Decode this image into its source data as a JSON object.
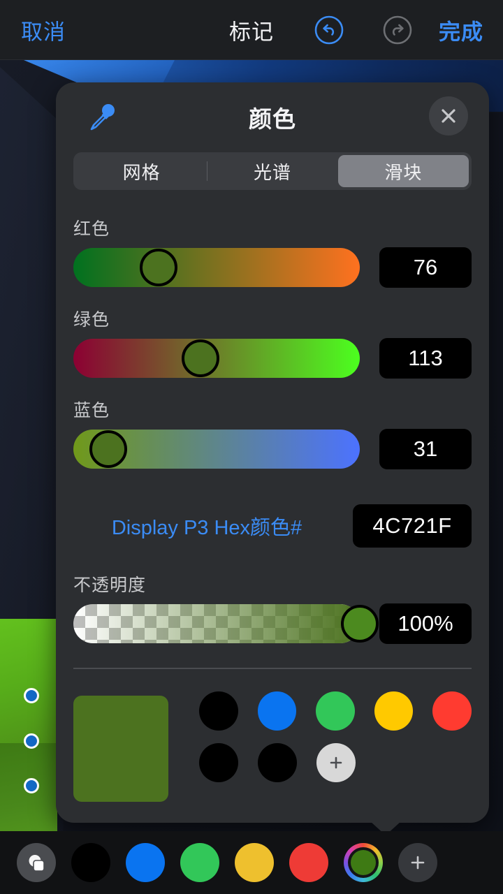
{
  "topbar": {
    "cancel_label": "取消",
    "title": "标记",
    "done_label": "完成",
    "undo_icon": "undo-icon",
    "redo_icon": "redo-icon",
    "undo_color": "#3b8cf5",
    "redo_color": "#6d6f73"
  },
  "popover": {
    "title": "颜色",
    "eyedropper_icon": "eyedropper-icon",
    "close_icon": "close-icon",
    "segments": [
      {
        "label": "网格",
        "selected": false
      },
      {
        "label": "光谱",
        "selected": false
      },
      {
        "label": "滑块",
        "selected": true
      }
    ],
    "sliders": [
      {
        "label": "红色",
        "value": "76",
        "percent": 29.8,
        "gradient_from": "#00711f",
        "gradient_to": "#ff711f",
        "thumb_color": "#4C721F"
      },
      {
        "label": "绿色",
        "value": "113",
        "percent": 44.3,
        "gradient_from": "#8c0033",
        "gradient_to": "#4cff1f",
        "thumb_color": "#4C721F"
      },
      {
        "label": "蓝色",
        "value": "31",
        "percent": 12.2,
        "gradient_from": "#70991a",
        "gradient_to": "#4c72ff",
        "thumb_color": "#4C721F"
      }
    ],
    "hex": {
      "label": "Display P3 Hex颜色#",
      "value": "4C721F"
    },
    "opacity": {
      "label": "不透明度",
      "value": "100%",
      "percent": 100,
      "color": "#4C721F",
      "thumb_color": "#4C8A1F"
    },
    "current_color": "#4C721F",
    "swatch_rows": [
      [
        "#000000",
        "#0a74f0",
        "#32c759",
        "#ffc900",
        "#ff3b30"
      ],
      [
        "#000000",
        "#000000"
      ]
    ],
    "add_swatch_icon": "plus-icon"
  },
  "bottombar": {
    "opacity_icon": "layers-opacity-icon",
    "swatches": [
      "#000000",
      "#0a74f0",
      "#32c759",
      "#eec02e",
      "#ee3b36"
    ],
    "picker_icon": "color-wheel-icon",
    "picker_color": "#3e7a14",
    "add_icon": "plus-icon"
  },
  "canvas": {
    "shape_color": "#4e8f18",
    "handle_color": "#1469c7"
  }
}
